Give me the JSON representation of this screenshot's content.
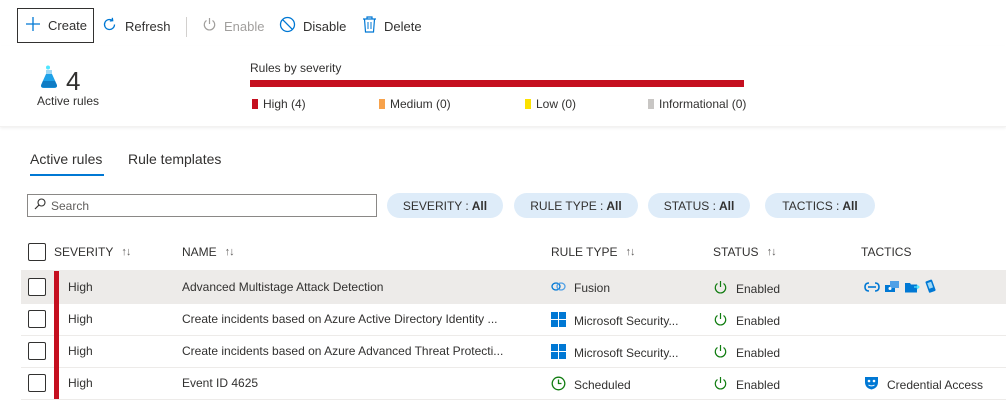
{
  "toolbar": {
    "create": "Create",
    "refresh": "Refresh",
    "enable": "Enable",
    "disable": "Disable",
    "delete": "Delete"
  },
  "summary": {
    "active_count": "4",
    "active_label": "Active rules",
    "severity_title": "Rules by severity",
    "legend": [
      {
        "label": "High (4)",
        "color": "#c50f1f"
      },
      {
        "label": "Medium (0)",
        "color": "#f7a24b"
      },
      {
        "label": "Low (0)",
        "color": "#fce100"
      },
      {
        "label": "Informational (0)",
        "color": "#c8c6c4"
      }
    ]
  },
  "tabs": [
    {
      "label": "Active rules",
      "active": true
    },
    {
      "label": "Rule templates",
      "active": false
    }
  ],
  "search": {
    "placeholder": "Search"
  },
  "filters": [
    {
      "name": "SEVERITY :",
      "value": "All"
    },
    {
      "name": "RULE TYPE :",
      "value": "All"
    },
    {
      "name": "STATUS :",
      "value": "All"
    },
    {
      "name": "TACTICS :",
      "value": "All"
    }
  ],
  "table": {
    "headers": {
      "severity": "SEVERITY",
      "name": "NAME",
      "rule_type": "RULE TYPE",
      "status": "STATUS",
      "tactics": "TACTICS"
    },
    "rows": [
      {
        "severity": "High",
        "name": "Advanced Multistage Attack Detection",
        "rule_type": "Fusion",
        "rule_icon": "fusion-icon",
        "status": "Enabled",
        "tactics": ""
      },
      {
        "severity": "High",
        "name": "Create incidents based on Azure Active Directory Identity ...",
        "rule_type": "Microsoft Security...",
        "rule_icon": "windows-icon",
        "status": "Enabled",
        "tactics": ""
      },
      {
        "severity": "High",
        "name": "Create incidents based on Azure Advanced Threat Protecti...",
        "rule_type": "Microsoft Security...",
        "rule_icon": "windows-icon",
        "status": "Enabled",
        "tactics": ""
      },
      {
        "severity": "High",
        "name": "Event ID 4625",
        "rule_type": "Scheduled",
        "rule_icon": "clock-icon",
        "status": "Enabled",
        "tactics": "Credential Access"
      }
    ]
  },
  "colors": {
    "accent": "#0078d4",
    "high": "#c50f1f",
    "enabled_green": "#107c10"
  }
}
